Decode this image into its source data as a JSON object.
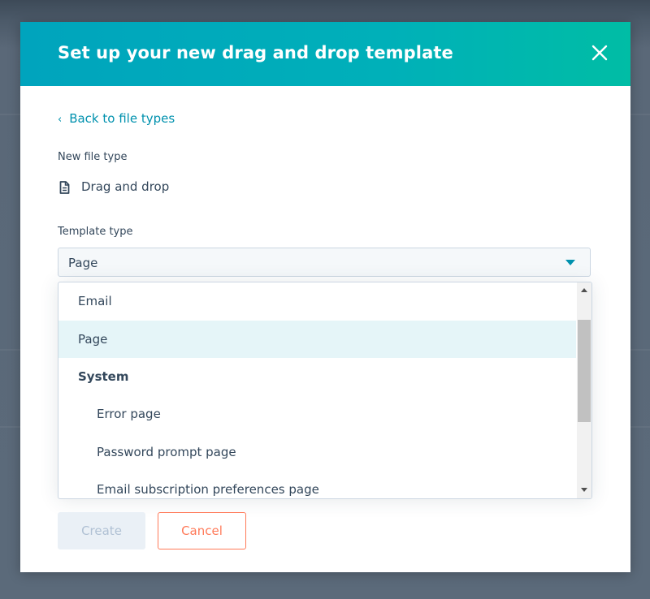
{
  "modal": {
    "title": "Set up your new drag and drop template",
    "close_icon": "close-icon"
  },
  "back_link": {
    "chevron": "‹",
    "label": "Back to file types"
  },
  "file_type": {
    "label": "New file type",
    "icon": "file-icon",
    "value": "Drag and drop"
  },
  "template_type": {
    "label": "Template type",
    "selected_value": "Page",
    "options": [
      {
        "label": "Email",
        "kind": "option",
        "selected": false
      },
      {
        "label": "Page",
        "kind": "option",
        "selected": true
      },
      {
        "label": "System",
        "kind": "group",
        "selected": false
      },
      {
        "label": "Error page",
        "kind": "sub-option",
        "selected": false
      },
      {
        "label": "Password prompt page",
        "kind": "sub-option",
        "selected": false
      },
      {
        "label": "Email subscription preferences page",
        "kind": "sub-option",
        "selected": false
      }
    ]
  },
  "actions": {
    "create_label": "Create",
    "cancel_label": "Cancel"
  },
  "colors": {
    "header_start": "#00a4bd",
    "header_end": "#00bda5",
    "link": "#0091ae",
    "text": "#33475b",
    "selected_option_bg": "#e5f5f8",
    "cancel_accent": "#ff7a59",
    "disabled_bg": "#eaf0f6"
  }
}
